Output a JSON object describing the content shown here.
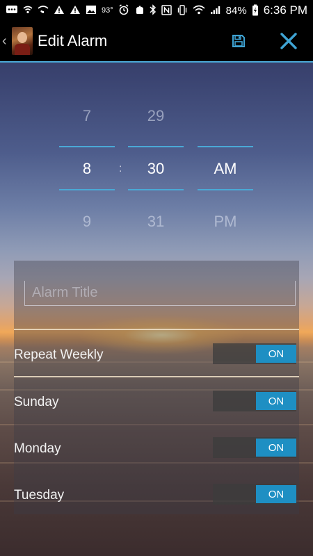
{
  "status_bar": {
    "temperature": "93°",
    "battery": "84%",
    "time": "6:36 PM"
  },
  "app_bar": {
    "title": "Edit Alarm",
    "back_icon": "chevron-left-icon",
    "save_icon": "floppy-disk-icon",
    "close_icon": "close-icon"
  },
  "time_picker": {
    "hour": {
      "prev": "7",
      "current": "8",
      "next": "9"
    },
    "separator": ":",
    "minute": {
      "prev": "29",
      "current": "30",
      "next": "31"
    },
    "period": {
      "current": "AM",
      "next": "PM"
    }
  },
  "form": {
    "title_placeholder": "Alarm Title",
    "title_value": "",
    "rows": [
      {
        "label": "Repeat Weekly",
        "toggle": "ON"
      },
      {
        "label": "Sunday",
        "toggle": "ON"
      },
      {
        "label": "Monday",
        "toggle": "ON"
      },
      {
        "label": "Tuesday",
        "toggle": "ON"
      }
    ]
  },
  "colors": {
    "accent": "#4aa9d6",
    "toggle_on": "#1e8fc3"
  }
}
